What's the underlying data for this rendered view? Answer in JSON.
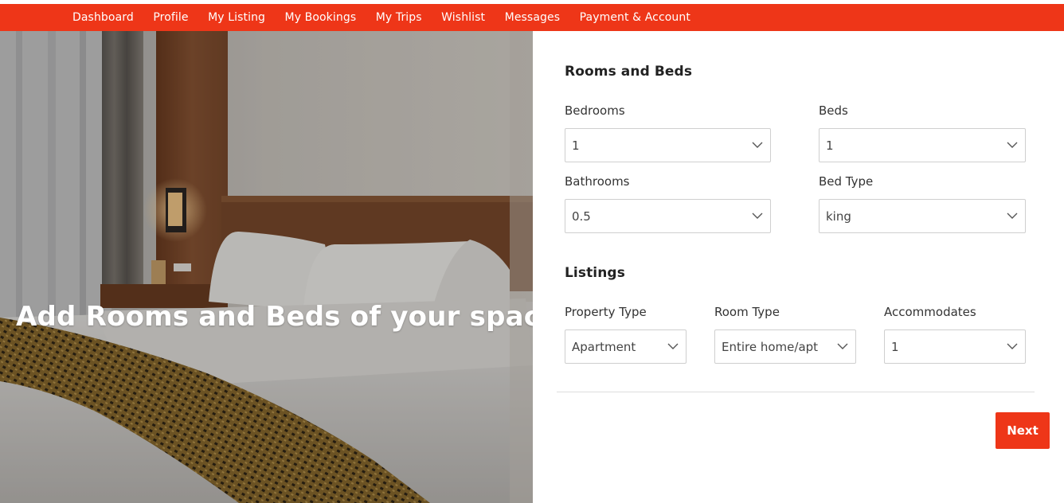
{
  "nav": {
    "items": [
      "Dashboard",
      "Profile",
      "My Listing",
      "My Bookings",
      "My Trips",
      "Wishlist",
      "Messages",
      "Payment & Account"
    ]
  },
  "hero": {
    "title": "Add Rooms and Beds of your space",
    "image": "hotel-bedroom-photo"
  },
  "rooms_section": {
    "title": "Rooms and Beds",
    "bedrooms": {
      "label": "Bedrooms",
      "value": "1"
    },
    "beds": {
      "label": "Beds",
      "value": "1"
    },
    "bathrooms": {
      "label": "Bathrooms",
      "value": "0.5"
    },
    "bed_type": {
      "label": "Bed Type",
      "value": "king"
    }
  },
  "listings_section": {
    "title": "Listings",
    "property_type": {
      "label": "Property Type",
      "value": "Apartment"
    },
    "room_type": {
      "label": "Room Type",
      "value": "Entire home/apt"
    },
    "accommodates": {
      "label": "Accommodates",
      "value": "1"
    }
  },
  "actions": {
    "next_label": "Next"
  },
  "colors": {
    "accent": "#ee3618"
  },
  "icons": {
    "select_arrow": "chevron-down-icon"
  }
}
